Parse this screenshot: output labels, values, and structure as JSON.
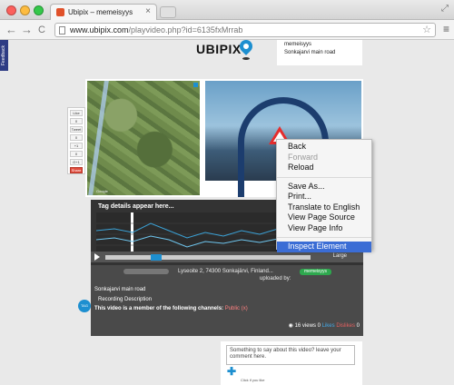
{
  "browser": {
    "tab_title": "Ubipix – memeisyys",
    "tab_close": "×",
    "url_host": "www.ubipix.com",
    "url_path": "/playvideo.php?id=6135fxMrrab",
    "back_glyph": "←",
    "forward_glyph": "→",
    "reload_glyph": "C",
    "star_glyph": "☆",
    "menu_glyph": "≡",
    "resize_glyph": "⤢"
  },
  "feedback_label": "Feedback",
  "site": {
    "logo_text": "UBIPIX",
    "info_user": "memeisyys",
    "info_road": "Sonkajarvi main road"
  },
  "share_rail": [
    "Like",
    "0",
    "Tweet",
    "0",
    "+1",
    "0",
    "G+1",
    "Share"
  ],
  "player": {
    "map_label": "Google",
    "graph_title": "Tag details appear here...",
    "ctrl_label": "Large"
  },
  "description": {
    "address": "Lyseoite 2, 74300 Sonkajärvi, Finland...",
    "uploaded_by": "uploaded by:",
    "uploader": "memeisyys",
    "road_name": "Sonkajarvi main road",
    "recording_description": "Recording Description",
    "channels_text": "This video is a member of the following channels:",
    "channels_link": "Public (x)",
    "tag_badge": "TAG",
    "views": "16 views",
    "likes": "Likes",
    "dislikes": "Dislikes",
    "like_count": "0",
    "dislike_count": "0"
  },
  "comment": {
    "placeholder": "Something to say about this video? leave your comment here.",
    "bottom_text": "Click if you like"
  },
  "context_menu": {
    "back": "Back",
    "forward": "Forward",
    "reload": "Reload",
    "save_as": "Save As...",
    "print": "Print...",
    "translate": "Translate to English",
    "view_source": "View Page Source",
    "view_info": "View Page Info",
    "inspect": "Inspect Element"
  },
  "colors": {
    "accent": "#1d8fd0",
    "menu_highlight": "#3b6dd5",
    "uploader_badge": "#2ea84e"
  }
}
